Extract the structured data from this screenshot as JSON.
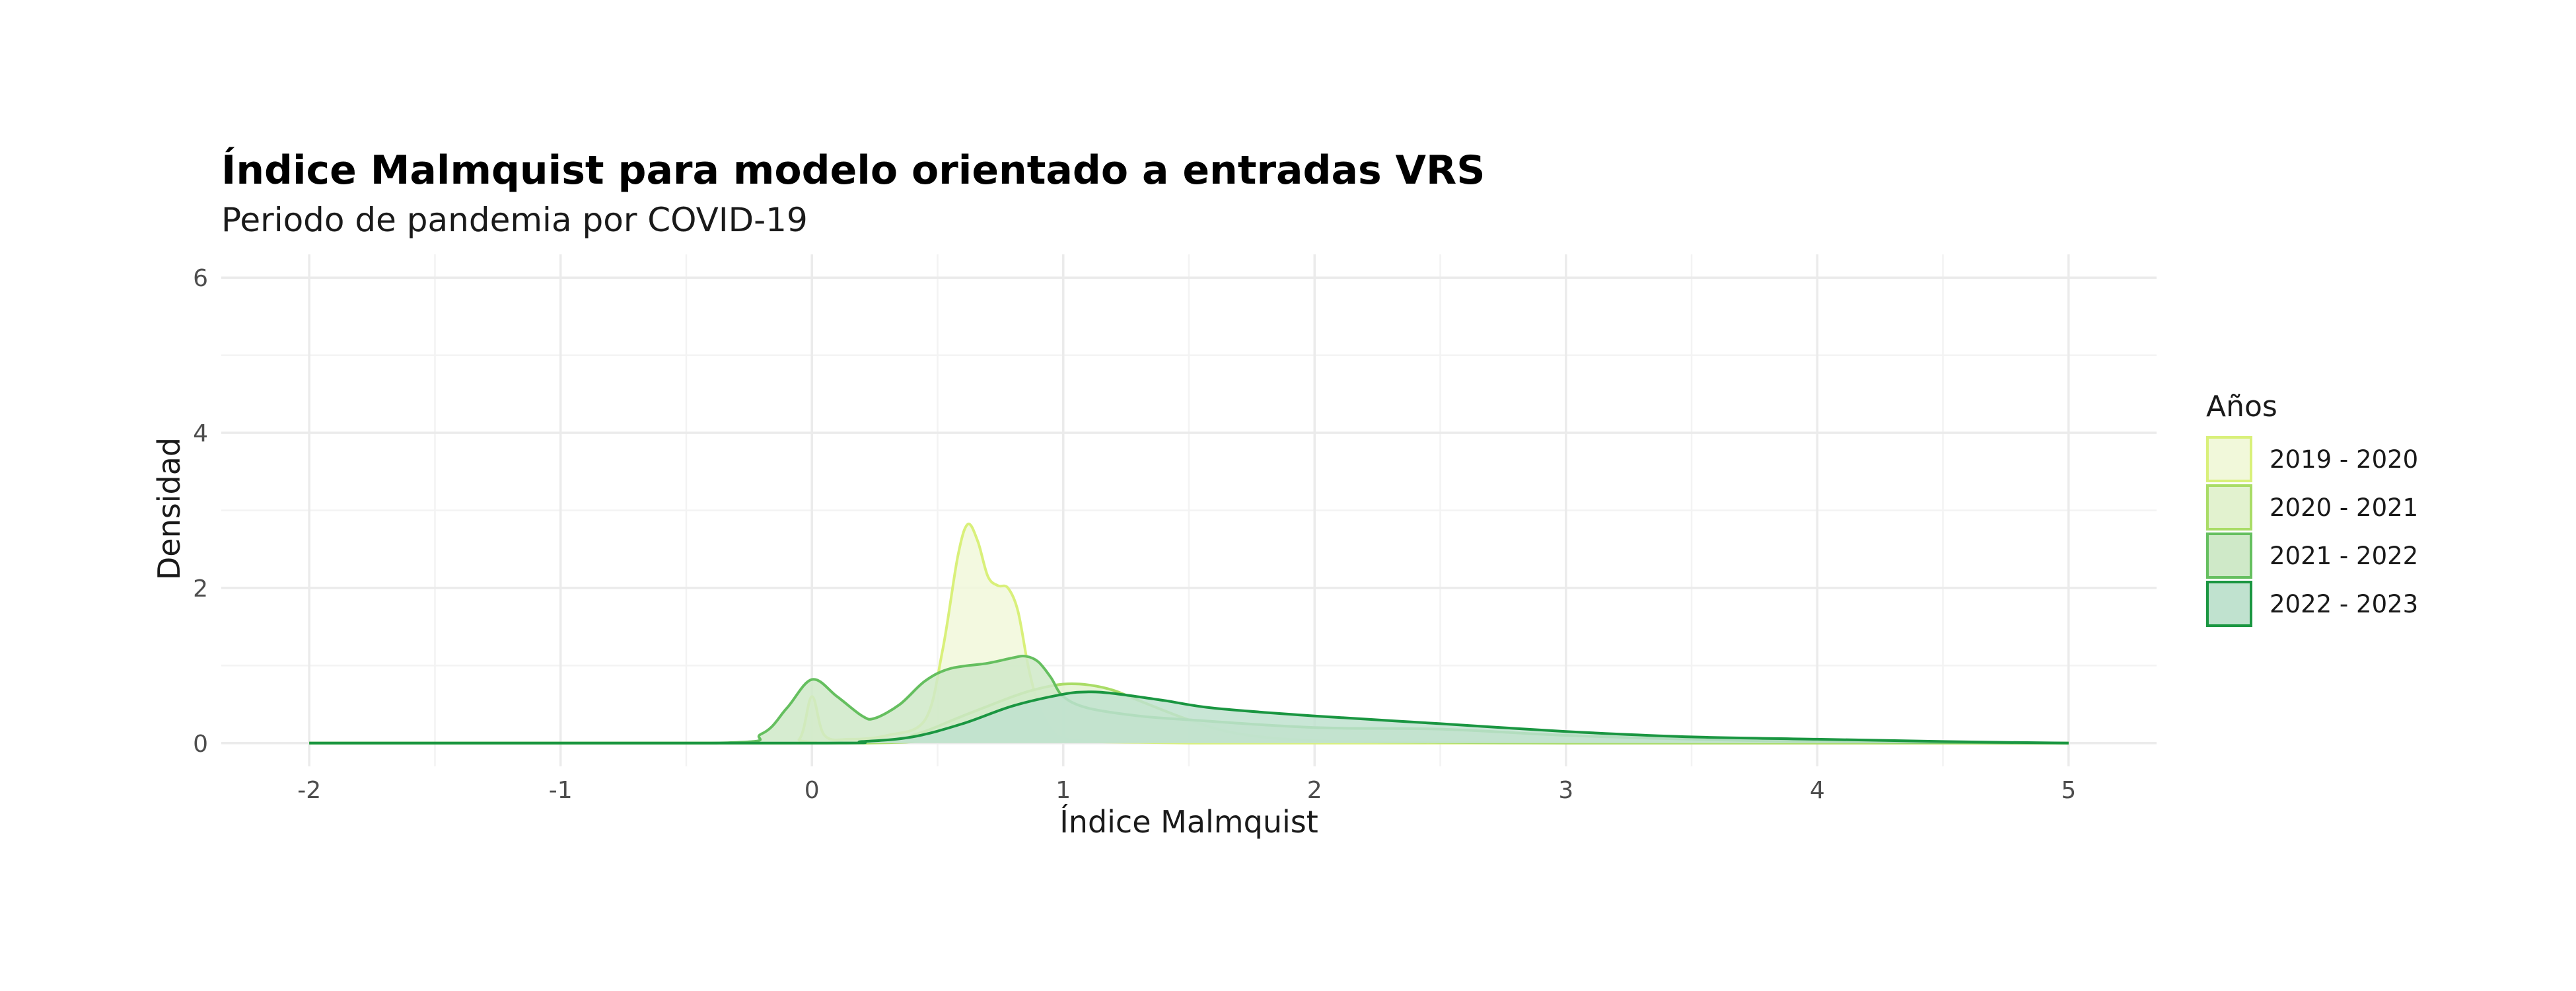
{
  "chart_data": {
    "type": "area",
    "title": "Índice Malmquist para modelo orientado a entradas VRS",
    "subtitle": "Periodo de pandemia por COVID-19",
    "xlabel": "Índice Malmquist",
    "ylabel": "Densidad",
    "xlim": [
      -2.35,
      5.35
    ],
    "ylim": [
      -0.3,
      6.3
    ],
    "x_ticks": [
      "-2",
      "-1",
      "0",
      "1",
      "2",
      "3",
      "4",
      "5"
    ],
    "y_ticks": [
      "0",
      "2",
      "4",
      "6"
    ],
    "grid": true,
    "legend": {
      "title": "Años",
      "position": "right"
    },
    "series": [
      {
        "name": "2019 - 2020",
        "fill": "#f1f8da",
        "stroke": "#d9f07a",
        "x": [
          -2,
          -0.15,
          -0.05,
          0,
          0.05,
          0.15,
          0.3,
          0.45,
          0.52,
          0.58,
          0.62,
          0.66,
          0.7,
          0.74,
          0.78,
          0.82,
          0.86,
          0.9,
          0.95,
          1.0,
          1.1,
          1.3,
          1.5,
          1.7,
          2.0,
          3.0,
          4.0,
          5.0
        ],
        "y": [
          0,
          0,
          0.05,
          0.6,
          0.1,
          0.05,
          0.1,
          0.3,
          1.2,
          2.4,
          2.82,
          2.6,
          2.15,
          2.03,
          2.0,
          1.7,
          1.0,
          0.5,
          0.18,
          0.06,
          0.02,
          0.01,
          0,
          0,
          0,
          0,
          0,
          0
        ]
      },
      {
        "name": "2020 - 2021",
        "fill": "#e2f2cf",
        "stroke": "#a9dc66",
        "x": [
          -2,
          0.2,
          0.4,
          0.6,
          0.8,
          0.9,
          1.0,
          1.1,
          1.2,
          1.3,
          1.5,
          1.7,
          2.0,
          2.5,
          3.0,
          3.5,
          4.0,
          5.0
        ],
        "y": [
          0,
          0,
          0.1,
          0.35,
          0.6,
          0.7,
          0.76,
          0.75,
          0.68,
          0.55,
          0.3,
          0.12,
          0.03,
          0.01,
          0,
          0,
          0,
          0
        ]
      },
      {
        "name": "2021 - 2022",
        "fill": "#cfe9c8",
        "stroke": "#65bf5f",
        "x": [
          -2,
          -0.4,
          -0.2,
          -0.1,
          0,
          0.1,
          0.2,
          0.25,
          0.35,
          0.45,
          0.55,
          0.7,
          0.8,
          0.85,
          0.9,
          0.95,
          1.0,
          1.1,
          1.3,
          1.5,
          2.0,
          2.5,
          3.0,
          3.5,
          4.0,
          5.0
        ],
        "y": [
          0,
          0,
          0.12,
          0.45,
          0.82,
          0.6,
          0.35,
          0.32,
          0.5,
          0.8,
          0.96,
          1.03,
          1.1,
          1.12,
          1.05,
          0.85,
          0.6,
          0.45,
          0.35,
          0.3,
          0.2,
          0.18,
          0.1,
          0.05,
          0.02,
          0
        ]
      },
      {
        "name": "2022 - 2023",
        "fill": "#c0e2cf",
        "stroke": "#1a9641",
        "x": [
          -2,
          0,
          0.2,
          0.4,
          0.6,
          0.8,
          1.0,
          1.1,
          1.2,
          1.4,
          1.6,
          2.0,
          2.5,
          3.0,
          3.5,
          4.0,
          4.5,
          5.0
        ],
        "y": [
          0,
          0,
          0.02,
          0.08,
          0.25,
          0.48,
          0.63,
          0.66,
          0.64,
          0.55,
          0.45,
          0.35,
          0.25,
          0.15,
          0.08,
          0.05,
          0.02,
          0
        ]
      }
    ]
  }
}
